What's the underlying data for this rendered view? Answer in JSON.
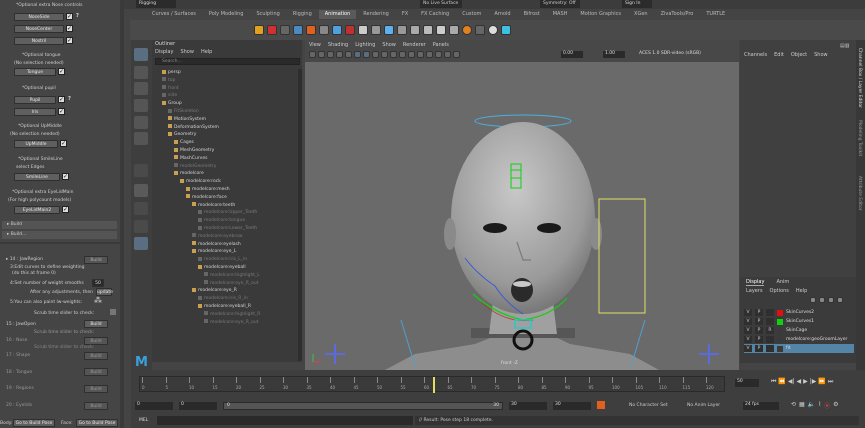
{
  "top_menu": {
    "mode": "Rigging",
    "profile": "No Live Surface",
    "symmetry": "Symmetry: Off",
    "signin": "Sign In"
  },
  "shelf_tabs": [
    "Curves / Surfaces",
    "Poly Modeling",
    "Sculpting",
    "Rigging",
    "Animation",
    "Rendering",
    "FX",
    "FX Caching",
    "Custom",
    "Arnold",
    "Bifrost",
    "MASH",
    "Motion Graphics",
    "XGen",
    "ZivaTools/Pro",
    "TURTLE"
  ],
  "active_shelf_tab": "Animation",
  "left_panel": {
    "header_label": "*Optional extra Nose controls",
    "nose_buttons": [
      "NoseSide",
      "NoseCenter",
      "Nostril"
    ],
    "tongue_header": "*Optional tongue",
    "tongue_sub": "(No selection needed)",
    "tongue_btn": "Tongue",
    "pupil_header": "*Optional pupil",
    "pupil_btns": [
      "Pupil",
      "Iris"
    ],
    "upmiddle_header": "*Optional UpMiddle",
    "upmiddle_sub": "(No selection needed)",
    "upmiddle_btn": "UpMiddle",
    "smileline_header": "*Optional SmileLine",
    "smileline_sub": "select Edges",
    "smileline_btn": "SmileLine",
    "eyelidmain_header": "*Optional extra EyeLidMain",
    "eyelidmain_sub": "(For high polycount models)",
    "eyelidmain_btn": "EyeLidMain2",
    "build_frames": [
      "Build",
      "Build..."
    ],
    "lower": {
      "build_label": "Build",
      "step3": "3:Edit curves to define weighting",
      "step3b": "(do this at frame 0)",
      "step4": "4:Set number of weight smooths",
      "smooth_value": "50",
      "after": "After any adjustments, then",
      "update_btn": "update",
      "step5": "5:You can also paint lw-weights:",
      "scrub": "Scrub time slider to check:",
      "jawopen_label": "15 : JawOpen",
      "sections": [
        "16 : Nose",
        "17 : Shape",
        "18 : Tongue",
        "19 : Regions",
        "20 : Eyelids"
      ]
    },
    "bottom": {
      "body_label": "Body:",
      "goto_build_pose": "Go to Build Pose",
      "face_label": "Face:",
      "goto_build_pose_2": "Go to Build Pose"
    }
  },
  "outliner": {
    "title": "Outliner",
    "menu": [
      "Display",
      "Show",
      "Help"
    ],
    "search_placeholder": "Search...",
    "items": [
      {
        "name": "persp",
        "indent": 1,
        "dim": false
      },
      {
        "name": "top",
        "indent": 1,
        "dim": true
      },
      {
        "name": "front",
        "indent": 1,
        "dim": true
      },
      {
        "name": "side",
        "indent": 1,
        "dim": true
      },
      {
        "name": "Group",
        "indent": 1,
        "dim": false
      },
      {
        "name": "FitSkeleton",
        "indent": 2,
        "dim": true
      },
      {
        "name": "MotionSystem",
        "indent": 2,
        "dim": false
      },
      {
        "name": "DeformationSystem",
        "indent": 2,
        "dim": false
      },
      {
        "name": "Geometry",
        "indent": 2,
        "dim": false
      },
      {
        "name": "Cages",
        "indent": 3,
        "dim": false
      },
      {
        "name": "MeshGeometry",
        "indent": 3,
        "dim": false
      },
      {
        "name": "MashCurves",
        "indent": 3,
        "dim": false
      },
      {
        "name": "modelGeometry",
        "indent": 3,
        "dim": true
      },
      {
        "name": "modelcore",
        "indent": 3,
        "dim": false
      },
      {
        "name": "modelcore:rock",
        "indent": 4,
        "dim": false
      },
      {
        "name": "modelcore:mesh",
        "indent": 5,
        "dim": false
      },
      {
        "name": "modelcore:face",
        "indent": 5,
        "dim": false
      },
      {
        "name": "modelcore:teeth",
        "indent": 6,
        "dim": false
      },
      {
        "name": "modelcore:Upper_Teeth",
        "indent": 7,
        "dim": true
      },
      {
        "name": "modelcore:tongue",
        "indent": 7,
        "dim": true
      },
      {
        "name": "modelcore:Lower_Teeth",
        "indent": 7,
        "dim": true
      },
      {
        "name": "modelcore:eyebrow",
        "indent": 6,
        "dim": true
      },
      {
        "name": "modelcore:eyelash",
        "indent": 6,
        "dim": false
      },
      {
        "name": "modelcore:eye_L",
        "indent": 6,
        "dim": false
      },
      {
        "name": "modelcore:iris_L_in",
        "indent": 7,
        "dim": true
      },
      {
        "name": "modelcore:eyeball",
        "indent": 7,
        "dim": false
      },
      {
        "name": "modelcore:highlight_L",
        "indent": 8,
        "dim": true
      },
      {
        "name": "modelcore:eye_R_out",
        "indent": 8,
        "dim": true
      },
      {
        "name": "modelcore:eye_R",
        "indent": 6,
        "dim": false
      },
      {
        "name": "modelcore:iris_R_in",
        "indent": 7,
        "dim": true
      },
      {
        "name": "modelcore:eyeball_R",
        "indent": 7,
        "dim": false
      },
      {
        "name": "modelcore:highlight_R",
        "indent": 8,
        "dim": true
      },
      {
        "name": "modelcore:eye_R_out",
        "indent": 8,
        "dim": true
      }
    ]
  },
  "viewport": {
    "menu": [
      "View",
      "Shading",
      "Lighting",
      "Show",
      "Renderer",
      "Panels"
    ],
    "values": [
      "0.00",
      "1.00"
    ],
    "colorspace": "ACES 1.0 SDR-video (sRGB)",
    "camera_label": "front -Z"
  },
  "channel_box": {
    "menu": [
      "Channels",
      "Edit",
      "Object",
      "Show"
    ],
    "layer_tabs": [
      "Display",
      "Anim"
    ],
    "layer_menu": [
      "Layers",
      "Options",
      "Help"
    ],
    "layers": [
      {
        "v": "V",
        "p": "P",
        "r": "",
        "color": "#e01010",
        "name": "SkinCurves2"
      },
      {
        "v": "V",
        "p": "P",
        "r": "",
        "color": "#10d010",
        "name": "SkinCurves1"
      },
      {
        "v": "V",
        "p": "P",
        "r": "R",
        "color": "#3a3a3a",
        "name": "SkinCage"
      },
      {
        "v": "V",
        "p": "P",
        "r": "",
        "color": "#3a3a3a",
        "name": "modelcore:geoGroomLayer"
      },
      {
        "v": "V",
        "p": "P",
        "r": "",
        "color": "#3a3a3a",
        "name": "fit"
      }
    ]
  },
  "side_tabs": [
    "Channel Box / Layer Editor",
    "Modeling Toolkit",
    "Attribute Editor"
  ],
  "timeline": {
    "ticks": [
      "0",
      "5",
      "10",
      "15",
      "20",
      "25",
      "30",
      "35",
      "40",
      "45",
      "50",
      "55",
      "60",
      "65",
      "70",
      "75",
      "80",
      "85",
      "90",
      "95",
      "100",
      "105",
      "110",
      "115",
      "120"
    ],
    "current_frame": "50",
    "range_start": "0",
    "range_start2": "0",
    "range_inner_start": "0",
    "range_inner_end": "30",
    "range_end": "30",
    "range_end2": "30",
    "character_set": "No Character Set",
    "anim_layer": "No Anim Layer",
    "fps": "24 fps"
  },
  "command_line": {
    "mel": "MEL",
    "result": "// Result: Pose step 18 complete."
  },
  "colors": {
    "accent": "#5285a6",
    "green": "#10d010",
    "red": "#e01010"
  }
}
